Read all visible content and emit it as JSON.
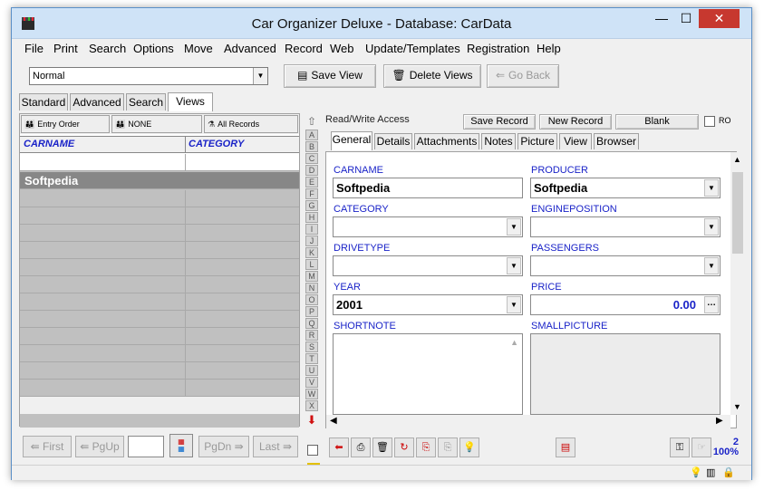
{
  "window": {
    "title": "Car Organizer Deluxe - Database: CarData",
    "controls": {
      "minimize": "—",
      "maximize": "☐",
      "close": "✕"
    }
  },
  "menu": [
    "File",
    "Print",
    "Search",
    "Options",
    "Move",
    "Advanced",
    "Record",
    "Web",
    "Update/Templates",
    "Registration",
    "Help"
  ],
  "toolbar": {
    "view_select": "Normal",
    "save_view": "Save View",
    "delete_views": "Delete Views",
    "go_back": "Go Back"
  },
  "left_tabs": [
    "Standard",
    "Advanced",
    "Search",
    "Views"
  ],
  "sort_buttons": [
    "Entry Order",
    "NONE",
    "All Records"
  ],
  "grid": {
    "columns": [
      "CARNAME",
      "CATEGORY"
    ],
    "selected_row": "Softpedia"
  },
  "alphabet": [
    "A",
    "B",
    "C",
    "D",
    "E",
    "F",
    "G",
    "H",
    "I",
    "J",
    "K",
    "L",
    "M",
    "N",
    "O",
    "P",
    "Q",
    "R",
    "S",
    "T",
    "U",
    "V",
    "W",
    "X"
  ],
  "record_bar": {
    "access": "Read/Write Access",
    "save_record": "Save Record",
    "new_record": "New Record",
    "blank": "Blank",
    "ro_label": "RO"
  },
  "record_tabs": [
    "General",
    "Details",
    "Attachments",
    "Notes",
    "Picture",
    "View",
    "Browser"
  ],
  "form": {
    "carname_label": "CARNAME",
    "carname": "Softpedia",
    "producer_label": "PRODUCER",
    "producer": "Softpedia",
    "category_label": "CATEGORY",
    "category": "",
    "engineposition_label": "ENGINEPOSITION",
    "engineposition": "",
    "drivetype_label": "DRIVETYPE",
    "drivetype": "",
    "passengers_label": "PASSENGERS",
    "passengers": "",
    "year_label": "YEAR",
    "year": "2001",
    "price_label": "PRICE",
    "price": "0.00",
    "shortnote_label": "SHORTNOTE",
    "smallpicture_label": "SMALLPICTURE"
  },
  "nav": {
    "first": "First",
    "pgup": "PgUp",
    "pgdn": "PgDn",
    "last": "Last"
  },
  "status": {
    "record_count": "2",
    "zoom": "100%"
  }
}
